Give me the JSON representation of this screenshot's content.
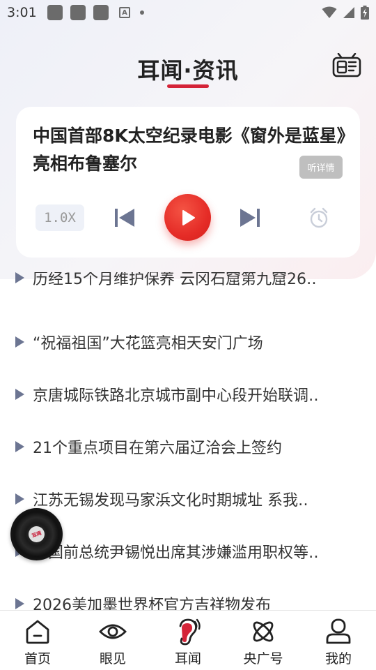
{
  "status_bar": {
    "time": "3:01",
    "notification_icons": [
      "app-icon",
      "app-icon",
      "app-icon",
      "font-a-icon",
      "dot-icon"
    ],
    "right_icons": [
      "wifi-icon",
      "cellular-icon",
      "battery-charging-icon"
    ]
  },
  "header": {
    "title": "耳闻·资讯",
    "accent_color": "#d42438",
    "right_icon": "radio-icon"
  },
  "player": {
    "title": "中国首部8K太空纪录电影《窗外是蓝星》亮相布鲁塞尔",
    "detail_label": "听详情",
    "speed_label": "1.0X",
    "controls": [
      "previous-icon",
      "play-icon",
      "next-icon",
      "alarm-clock-icon"
    ],
    "play_color": "#e52c27"
  },
  "news": {
    "items": [
      "历经15个月维护保养 云冈石窟第九窟26‥",
      "“祝福祖国”大花篮亮相天安门广场",
      "京唐城际铁路北京城市副中心段开始联调‥",
      "21个重点项目在第六届辽洽会上签约",
      "江苏无锡发现马家浜文化时期城址  系我‥",
      "韩国前总统尹锡悦出席其涉嫌滥用职权等‥",
      "2026美加墨世界杯官方吉祥物发布"
    ]
  },
  "disc": {
    "label": "耳闻",
    "icon": "vinyl-disc-icon"
  },
  "bottom_nav": {
    "items": [
      {
        "label": "首页",
        "icon": "home-icon"
      },
      {
        "label": "眼见",
        "icon": "eye-icon"
      },
      {
        "label": "耳闻",
        "icon": "ear-icon",
        "active": true
      },
      {
        "label": "央广号",
        "icon": "atom-icon"
      },
      {
        "label": "我的",
        "icon": "user-icon"
      }
    ]
  }
}
